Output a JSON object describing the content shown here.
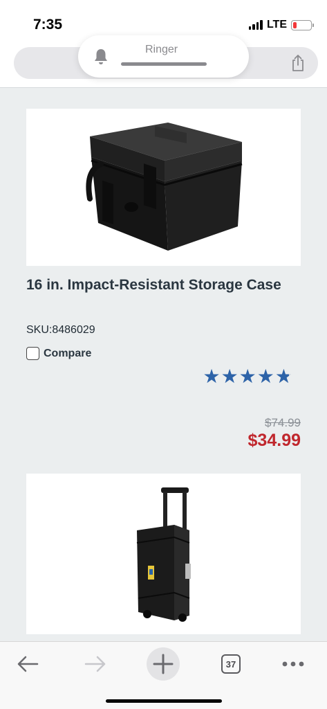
{
  "status_bar": {
    "time": "7:35",
    "network": "LTE",
    "battery_level": 0.2,
    "icons": [
      "signal-icon",
      "battery-icon"
    ]
  },
  "browser": {
    "share_icon": "share-icon",
    "ringer": {
      "label": "Ringer",
      "icon": "bell-icon"
    }
  },
  "product": {
    "title": "16 in. Impact-Resistant Storage Case",
    "sku": "SKU:8486029",
    "compare_label": "Compare",
    "rating": 4.8,
    "max_rating": 5,
    "price_original": "$74.99",
    "price_sale": "$34.99",
    "sale_color": "#c0272d",
    "star_color": "#2d63a8"
  },
  "toolbar": {
    "tab_count": "37",
    "icons": [
      "back-arrow-icon",
      "forward-arrow-icon",
      "plus-icon",
      "tabs-icon",
      "more-dots-icon"
    ]
  }
}
